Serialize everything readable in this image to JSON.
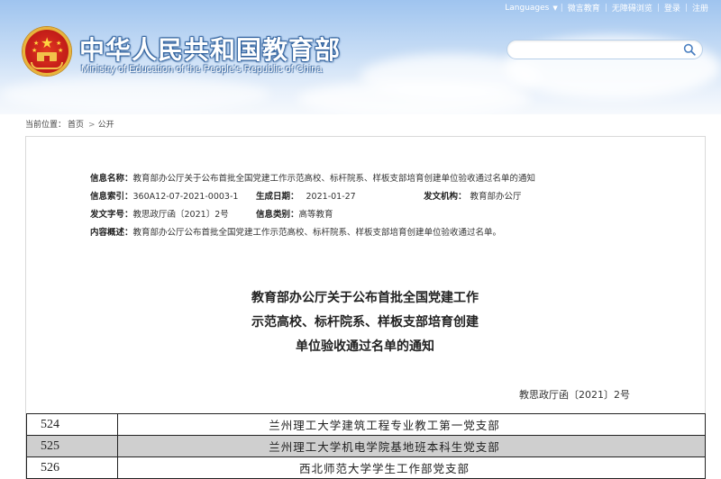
{
  "header": {
    "title": "中华人民共和国教育部",
    "subtitle": "Ministry of Education of the People's Republic of China",
    "nav": [
      "Languages",
      "微言教育",
      "无障碍浏览",
      "登录",
      "注册"
    ],
    "search": {
      "placeholder": ""
    }
  },
  "breadcrumb": {
    "prefix": "当前位置：",
    "items": [
      "首页",
      "公开"
    ]
  },
  "meta": {
    "name_label": "信息名称：",
    "name_value": "教育部办公厅关于公布首批全国党建工作示范高校、标杆院系、样板支部培育创建单位验收通过名单的通知",
    "index_label": "信息索引：",
    "index_value": "360A12-07-2021-0003-1",
    "date_label": "生成日期：",
    "date_value": "2021-01-27",
    "org_label": "发文机构：",
    "org_value": "教育部办公厅",
    "docno_label": "发文字号：",
    "docno_value": "教思政厅函〔2021〕2号",
    "category_label": "信息类别：",
    "category_value": "高等教育",
    "summary_label": "内容概述：",
    "summary_value": "教育部办公厅公布首批全国党建工作示范高校、标杆院系、样板支部培育创建单位验收通过名单。"
  },
  "document": {
    "title_lines": [
      "教育部办公厅关于公布首批全国党建工作",
      "示范高校、标杆院系、样板支部培育创建",
      "单位验收通过名单的通知"
    ],
    "number": "教思政厅函〔2021〕2号"
  },
  "table": {
    "rows": [
      {
        "num": "524",
        "name": "兰州理工大学建筑工程专业教工第一党支部"
      },
      {
        "num": "525",
        "name": "兰州理工大学机电学院基地班本科生党支部"
      },
      {
        "num": "526",
        "name": "西北师范大学学生工作部党支部"
      }
    ]
  },
  "colors": {
    "header_sky": "#9fc4ef",
    "emblem_red": "#c8201a",
    "emblem_gold": "#f2c14a",
    "highlight_row": "#cfcfcf"
  }
}
